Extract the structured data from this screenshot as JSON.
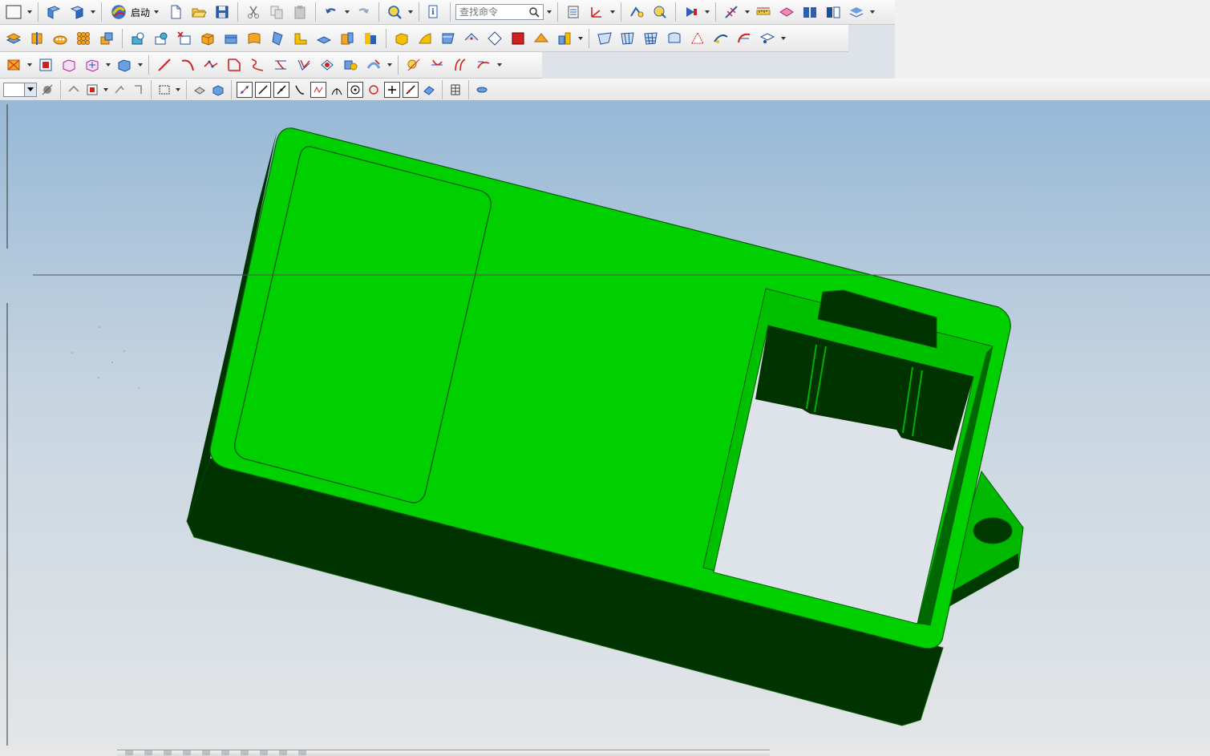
{
  "toolbar": {
    "start_label": "启动",
    "search_placeholder": "查找命令"
  },
  "model": {
    "body_color": "#00d000",
    "shade_color": "#003300",
    "edge_color": "#0a5a0a"
  },
  "icons": {
    "row1": [
      "select-window-icon",
      "view-orient-icon",
      "view-orient-2-icon",
      "start-nx-icon",
      "new-file-icon",
      "open-folder-icon",
      "save-icon",
      "cut-icon",
      "copy-icon",
      "paste-icon",
      "undo-icon",
      "redo-icon",
      "command-finder-icon",
      "information-icon",
      "layer-icon",
      "wcs-icon",
      "analysis-icon",
      "measure-icon",
      "ruler-icon",
      "section-icon",
      "book-icon"
    ],
    "row2": [
      "extrude-icon",
      "revolve-icon",
      "feature-pattern-icon",
      "hole-icon",
      "unite-icon",
      "subtract-icon",
      "intersect-icon",
      "block-icon",
      "cylinder-icon",
      "edge-blend-icon",
      "chamfer-icon",
      "shell-icon",
      "draft-icon",
      "thicken-icon",
      "offset-face-icon",
      "mirror-icon",
      "replace-face-icon",
      "surface-icon"
    ],
    "row3": [
      "datum-plane-icon",
      "datum-csys-icon",
      "point-icon",
      "sketch-icon",
      "line-icon",
      "arc-icon",
      "spline-icon",
      "project-curve-icon",
      "bridge-curve-icon",
      "offset-curve-icon",
      "join-curve-icon",
      "intersection-curve-icon"
    ],
    "row4": [
      "type-filter-icon",
      "selection-scope-icon",
      "snap-point-icon",
      "end-point-icon",
      "mid-point-icon",
      "control-point-icon",
      "intersection-point-icon",
      "center-point-icon",
      "quadrant-point-icon",
      "existing-point-icon",
      "point-on-curve-icon"
    ]
  }
}
